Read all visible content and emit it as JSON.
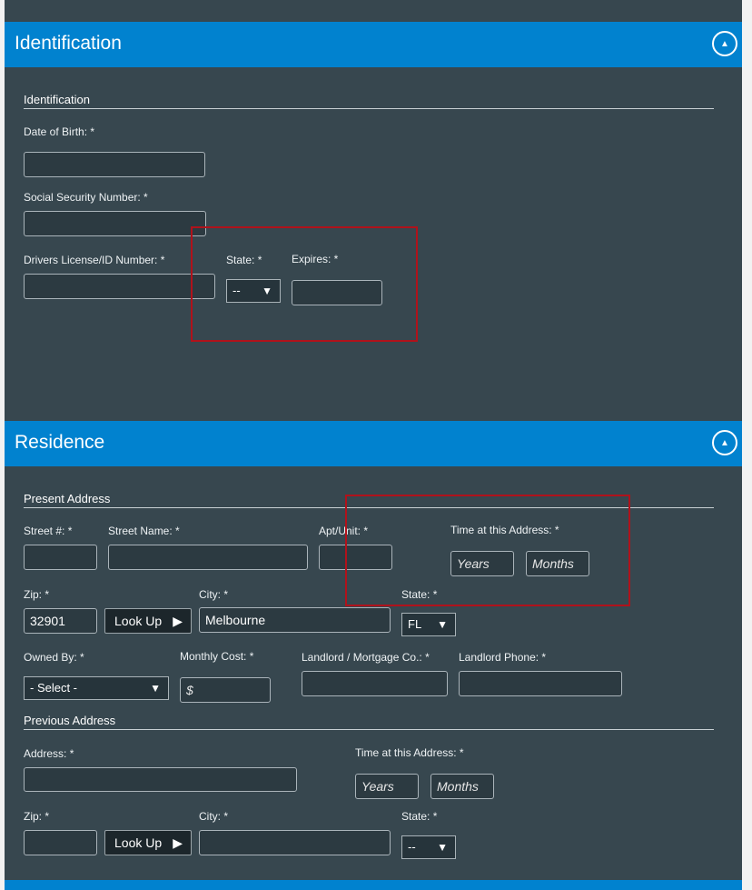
{
  "identification": {
    "header_title": "Identification",
    "collapse_icon": "chevron-up-icon",
    "subsection_title": "Identification",
    "dob_label": "Date of Birth: *",
    "ssn_label": "Social Security Number: *",
    "dl_label": "Drivers License/ID Number: *",
    "state_label": "State: *",
    "state_value": "--",
    "expires_label": "Expires: *"
  },
  "residence": {
    "header_title": "Residence",
    "collapse_icon": "chevron-up-icon",
    "present": {
      "title": "Present Address",
      "street_num_label": "Street #: *",
      "street_name_label": "Street Name: *",
      "apt_label": "Apt/Unit: *",
      "time_label": "Time at this Address: *",
      "years_placeholder": "Years",
      "months_placeholder": "Months",
      "zip_label": "Zip: *",
      "zip_value": "32901",
      "lookup_label": "Look Up",
      "city_label": "City: *",
      "city_value": "Melbourne",
      "state_label": "State: *",
      "state_value": "FL",
      "owned_by_label": "Owned By: *",
      "owned_by_value": "- Select -",
      "monthly_cost_label": "Monthly Cost: *",
      "monthly_cost_placeholder": "$",
      "landlord_label": "Landlord / Mortgage Co.: *",
      "landlord_phone_label": "Landlord Phone: *"
    },
    "previous": {
      "title": "Previous Address",
      "address_label": "Address: *",
      "time_label": "Time at this Address: *",
      "years_placeholder": "Years",
      "months_placeholder": "Months",
      "zip_label": "Zip: *",
      "lookup_label": "Look Up",
      "city_label": "City: *",
      "state_label": "State: *",
      "state_value": "--"
    }
  },
  "colors": {
    "header_blue": "#0182cf",
    "panel_bg": "#37474f",
    "highlight_red": "#b0121b"
  }
}
